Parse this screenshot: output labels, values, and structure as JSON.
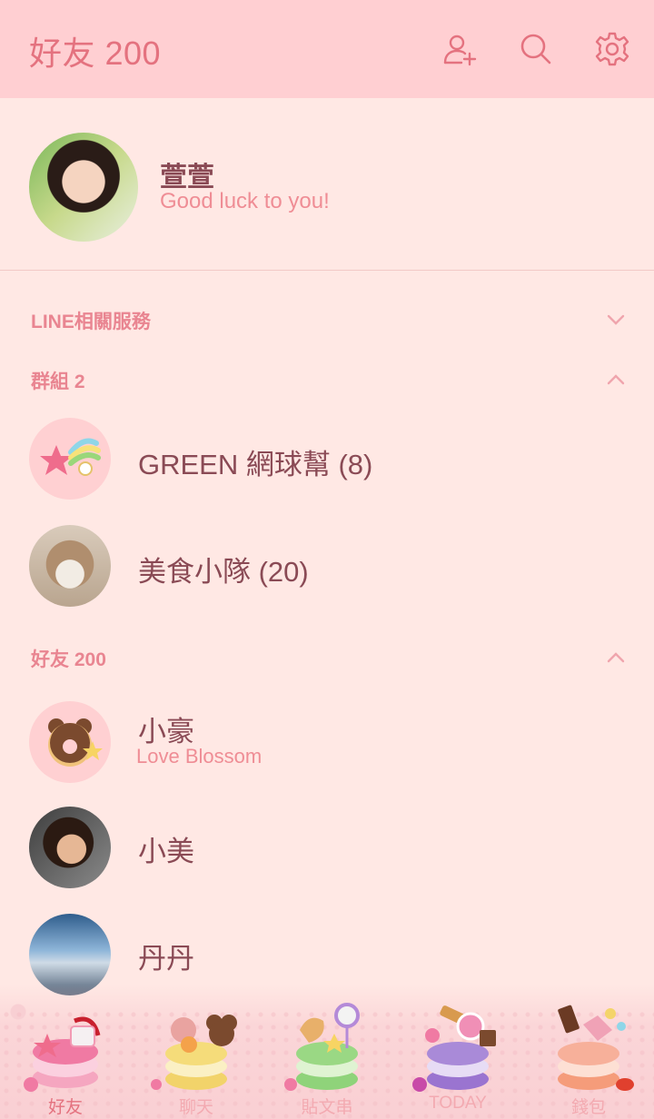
{
  "header": {
    "title": "好友 200",
    "icons": [
      "add-friend-icon",
      "search-icon",
      "gear-icon"
    ]
  },
  "profile": {
    "name": "萱萱",
    "status": "Good luck to you!"
  },
  "sections": {
    "services": "LINE相關服務",
    "groups": "群組 2",
    "friends": "好友 200"
  },
  "groups": [
    {
      "name": "GREEN 網球幫 (8)"
    },
    {
      "name": "美食小隊 (20)"
    }
  ],
  "friends": [
    {
      "name": "小豪",
      "status": "Love Blossom"
    },
    {
      "name": "小美"
    },
    {
      "name": "丹丹"
    }
  ],
  "tabs": [
    {
      "label": "好友",
      "active": true
    },
    {
      "label": "聊天"
    },
    {
      "label": "貼文串"
    },
    {
      "label": "TODAY"
    },
    {
      "label": "錢包"
    }
  ],
  "colors": {
    "header_bg": "#ffcfd2",
    "page_bg": "#ffe8e4",
    "accent": "#e4727f",
    "name_text": "#8a4a55"
  }
}
